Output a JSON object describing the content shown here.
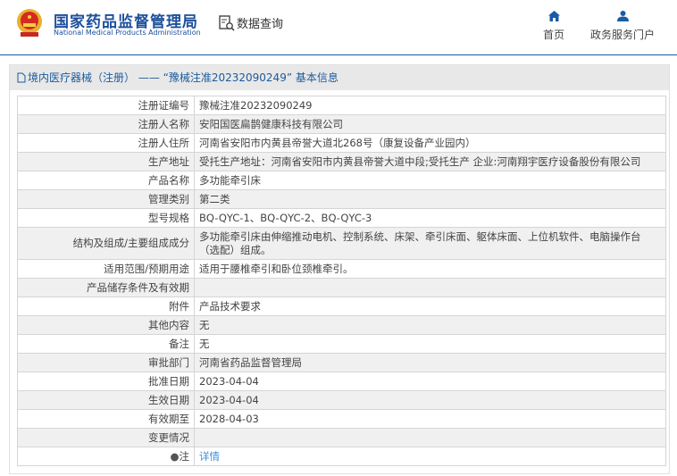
{
  "header": {
    "brand_cn": "国家药品监督管理局",
    "brand_en": "National Medical Products Administration",
    "query_label": "数据查询",
    "nav": [
      {
        "label": "首页",
        "icon": "home-icon"
      },
      {
        "label": "政务服务门户",
        "icon": "user-icon"
      }
    ]
  },
  "panel": {
    "title": "境内医疗器械（注册） —— “豫械注准20232090249” 基本信息"
  },
  "rows": [
    {
      "label": "注册证编号",
      "value": "豫械注准20232090249"
    },
    {
      "label": "注册人名称",
      "value": "安阳国医扁鹊健康科技有限公司"
    },
    {
      "label": "注册人住所",
      "value": "河南省安阳市内黄县帝誉大道北268号（康复设备产业园内）"
    },
    {
      "label": "生产地址",
      "value": "受托生产地址：河南省安阳市内黄县帝誉大道中段;受托生产 企业:河南翔宇医疗设备股份有限公司"
    },
    {
      "label": "产品名称",
      "value": "多功能牵引床"
    },
    {
      "label": "管理类别",
      "value": "第二类"
    },
    {
      "label": "型号规格",
      "value": "BQ-QYC-1、BQ-QYC-2、BQ-QYC-3"
    },
    {
      "label": "结构及组成/主要组成成分",
      "value": "多功能牵引床由伸缩推动电机、控制系统、床架、牵引床面、躯体床面、上位机软件、电脑操作台（选配）组成。"
    },
    {
      "label": "适用范围/预期用途",
      "value": "适用于腰椎牵引和卧位颈椎牵引。"
    },
    {
      "label": "产品储存条件及有效期",
      "value": ""
    },
    {
      "label": "附件",
      "value": "产品技术要求"
    },
    {
      "label": "其他内容",
      "value": "无"
    },
    {
      "label": "备注",
      "value": "无"
    },
    {
      "label": "审批部门",
      "value": "河南省药品监督管理局"
    },
    {
      "label": "批准日期",
      "value": "2023-04-04"
    },
    {
      "label": "生效日期",
      "value": "2023-04-04"
    },
    {
      "label": "有效期至",
      "value": "2028-04-03"
    },
    {
      "label": "变更情况",
      "value": ""
    }
  ],
  "note": {
    "label": "注",
    "link": "详情"
  }
}
